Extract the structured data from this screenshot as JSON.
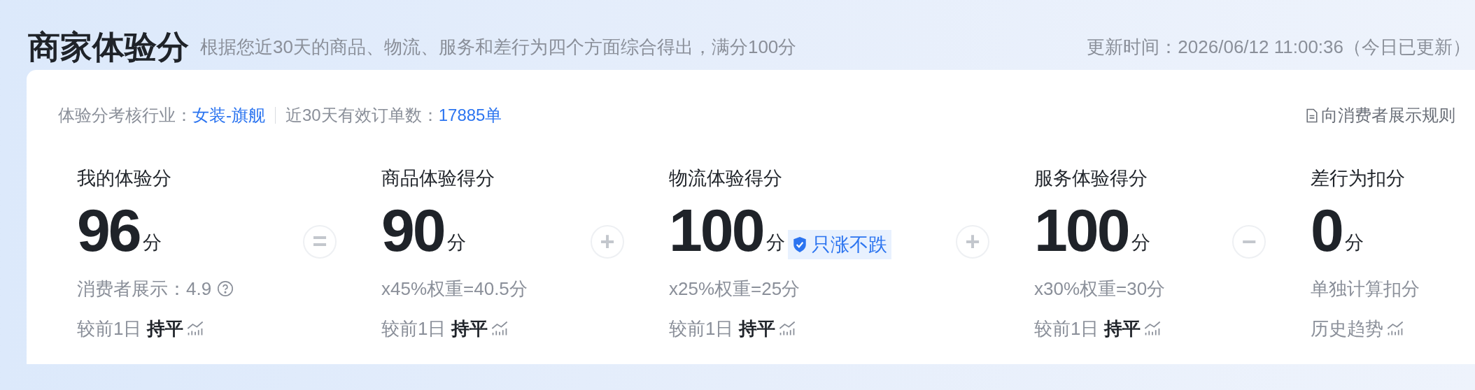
{
  "header": {
    "title": "商家体验分",
    "subtitle": "根据您近30天的商品、物流、服务和差行为四个方面综合得出，满分100分",
    "update_time": "更新时间：2026/06/12 11:00:36（今日已更新）"
  },
  "info": {
    "industry_label": "体验分考核行业：",
    "industry_value": "女装-旗舰",
    "orders_label": "近30天有效订单数：",
    "orders_value": "17885单",
    "rules_link": "向消费者展示规则"
  },
  "metrics": [
    {
      "label": "我的体验分",
      "value": "96",
      "unit": "分",
      "detail": "消费者展示：4.9",
      "help": true,
      "trend_label": "较前1日",
      "trend_value": "持平",
      "operator_after": "="
    },
    {
      "label": "商品体验得分",
      "value": "90",
      "unit": "分",
      "detail": "x45%权重=40.5分",
      "help": false,
      "trend_label": "较前1日",
      "trend_value": "持平",
      "operator_after": "+"
    },
    {
      "label": "物流体验得分",
      "value": "100",
      "unit": "分",
      "badge": "只涨不跌",
      "detail": "x25%权重=25分",
      "help": false,
      "trend_label": "较前1日",
      "trend_value": "持平",
      "operator_after": "+"
    },
    {
      "label": "服务体验得分",
      "value": "100",
      "unit": "分",
      "detail": "x30%权重=30分",
      "help": false,
      "trend_label": "较前1日",
      "trend_value": "持平",
      "operator_after": "−"
    },
    {
      "label": "差行为扣分",
      "value": "0",
      "unit": "分",
      "detail": "单独计算扣分",
      "help": false,
      "trend_label": "历史趋势"
    }
  ]
}
